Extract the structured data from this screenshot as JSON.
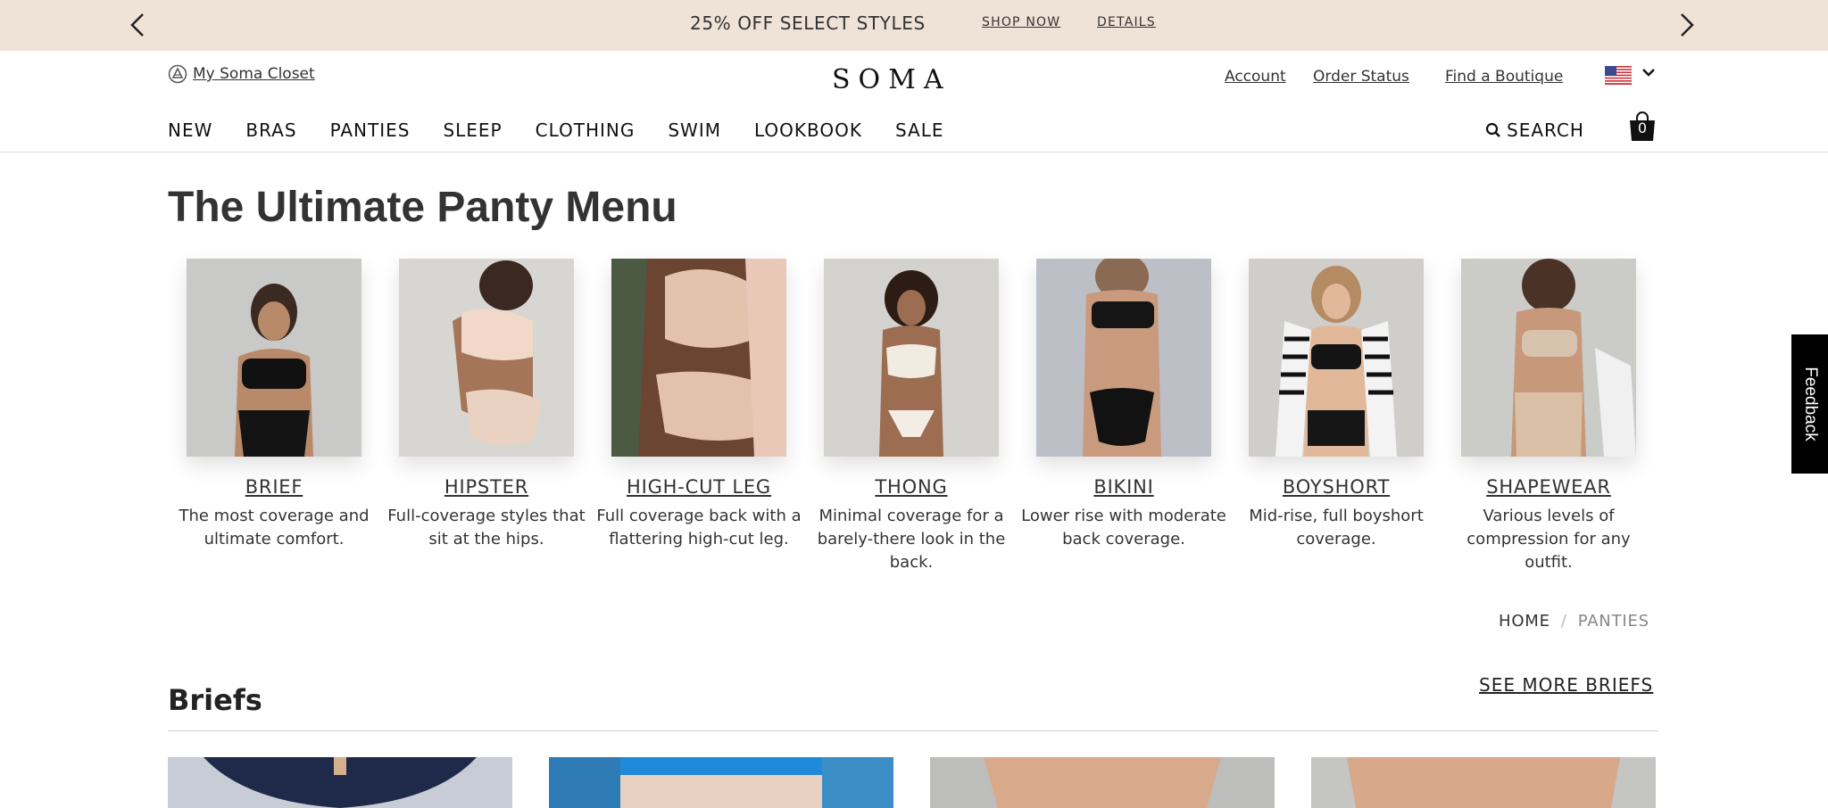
{
  "promo": {
    "text": "25% OFF SELECT STYLES",
    "shop_now": "SHOP NOW",
    "details": "DETAILS",
    "prev_icon": "chevron-left-icon",
    "next_icon": "chevron-right-icon"
  },
  "header": {
    "closet_label": "My Soma Closet",
    "logo": "SOMA",
    "account": "Account",
    "order_status": "Order Status",
    "find_boutique": "Find a Boutique",
    "country_icon": "us-flag-icon",
    "cart_count": "0"
  },
  "nav": {
    "items": [
      "NEW",
      "BRAS",
      "PANTIES",
      "SLEEP",
      "CLOTHING",
      "SWIM",
      "LOOKBOOK",
      "SALE"
    ],
    "search_label": "SEARCH"
  },
  "page": {
    "title": "The Ultimate Panty Menu"
  },
  "panty_menu": [
    {
      "name": "BRIEF",
      "description": "The most coverage and ultimate comfort."
    },
    {
      "name": "HIPSTER",
      "description": "Full-coverage styles that sit at the hips."
    },
    {
      "name": "HIGH-CUT LEG",
      "description": "Full coverage back with a flattering high-cut leg."
    },
    {
      "name": "THONG",
      "description": "Minimal coverage for a barely-there look in the back."
    },
    {
      "name": "BIKINI",
      "description": "Lower rise with moderate back coverage."
    },
    {
      "name": "BOYSHORT",
      "description": "Mid-rise, full boyshort coverage."
    },
    {
      "name": "SHAPEWEAR",
      "description": "Various levels of compression for any outfit."
    }
  ],
  "breadcrumb": {
    "home": "HOME",
    "separator": "/",
    "current": "PANTIES"
  },
  "section": {
    "title": "Briefs",
    "see_more": "SEE MORE BRIEFS"
  },
  "feedback": {
    "label": "Feedback"
  },
  "colors": {
    "promo_bg": "#efe2d6",
    "text_dark": "#222222",
    "feedback_bg": "#000000"
  }
}
